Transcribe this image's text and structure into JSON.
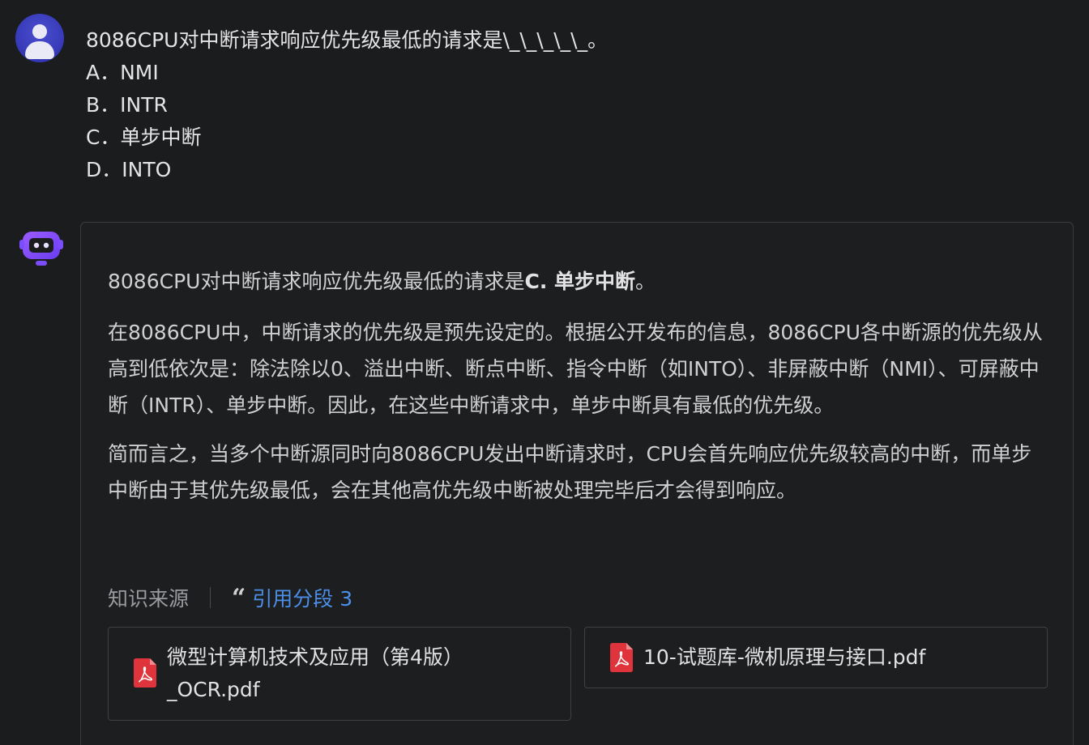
{
  "user_message": {
    "question": "8086CPU对中断请求响应优先级最低的请求是\\_\\_\\_\\_\\_。",
    "options": [
      "A．NMI",
      "B．INTR",
      "C．单步中断",
      "D．INTO"
    ]
  },
  "bot_message": {
    "p1_prefix": "8086CPU对中断请求响应优先级最低的请求是",
    "p1_bold": "C. 单步中断",
    "p1_suffix": "。",
    "p2": "在8086CPU中，中断请求的优先级是预先设定的。根据公开发布的信息，8086CPU各中断源的优先级从高到低依次是：除法除以0、溢出中断、断点中断、指令中断（如INTO）、非屏蔽中断（NMI）、可屏蔽中断（INTR）、单步中断。因此，在这些中断请求中，单步中断具有最低的优先级。",
    "p3": "简而言之，当多个中断源同时向8086CPU发出中断请求时，CPU会首先响应优先级较高的中断，而单步中断由于其优先级最低，会在其他高优先级中断被处理完毕后才会得到响应。",
    "sources_label": "知识来源",
    "quote_icon": "quote-icon",
    "citation_label": "引用分段 3",
    "files": [
      {
        "name": "微型计算机技术及应用（第4版）_OCR.pdf",
        "icon": "pdf-icon"
      },
      {
        "name": "10-试题库-微机原理与接口.pdf",
        "icon": "pdf-icon"
      }
    ]
  },
  "colors": {
    "background": "#1b1c1e",
    "link": "#4c8fe8",
    "user_avatar": "#3538b6",
    "bot_avatar": "#7c4dff",
    "pdf_icon": "#e0343c"
  }
}
